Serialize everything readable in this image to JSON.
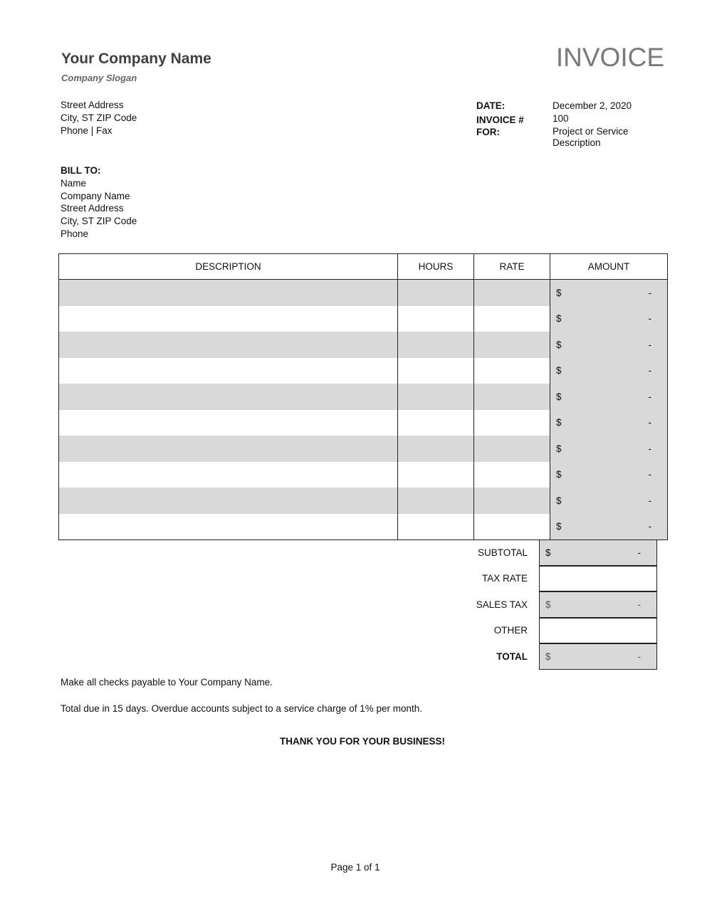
{
  "header": {
    "company_name": "Your Company Name",
    "company_slogan": "Company Slogan",
    "document_title": "INVOICE"
  },
  "from": {
    "lines": [
      "Street Address",
      "City, ST  ZIP Code",
      "Phone | Fax"
    ]
  },
  "meta": {
    "rows": [
      {
        "label": "DATE:",
        "value": "December 2, 2020"
      },
      {
        "label": "INVOICE #",
        "value": "100"
      },
      {
        "label": "FOR:",
        "value": "Project or Service Description"
      }
    ]
  },
  "bill_to": {
    "heading": "BILL TO:",
    "lines": [
      "Name",
      "Company Name",
      "Street Address",
      "City, ST  ZIP Code",
      "Phone"
    ]
  },
  "items_table": {
    "columns": [
      "DESCRIPTION",
      "HOURS",
      "RATE",
      "AMOUNT"
    ],
    "rows": [
      {
        "description": "",
        "hours": "",
        "rate": "",
        "currency": "$",
        "amount": "-"
      },
      {
        "description": "",
        "hours": "",
        "rate": "",
        "currency": "$",
        "amount": "-"
      },
      {
        "description": "",
        "hours": "",
        "rate": "",
        "currency": "$",
        "amount": "-"
      },
      {
        "description": "",
        "hours": "",
        "rate": "",
        "currency": "$",
        "amount": "-"
      },
      {
        "description": "",
        "hours": "",
        "rate": "",
        "currency": "$",
        "amount": "-"
      },
      {
        "description": "",
        "hours": "",
        "rate": "",
        "currency": "$",
        "amount": "-"
      },
      {
        "description": "",
        "hours": "",
        "rate": "",
        "currency": "$",
        "amount": "-"
      },
      {
        "description": "",
        "hours": "",
        "rate": "",
        "currency": "$",
        "amount": "-"
      },
      {
        "description": "",
        "hours": "",
        "rate": "",
        "currency": "$",
        "amount": "-"
      },
      {
        "description": "",
        "hours": "",
        "rate": "",
        "currency": "$",
        "amount": "-"
      }
    ]
  },
  "totals": {
    "subtotal": {
      "label": "SUBTOTAL",
      "currency": "$",
      "value": "-"
    },
    "tax_rate": {
      "label": "TAX RATE",
      "value": ""
    },
    "sales_tax": {
      "label": "SALES TAX",
      "currency": "$",
      "value": "-"
    },
    "other": {
      "label": "OTHER",
      "value": ""
    },
    "total": {
      "label": "TOTAL",
      "currency": "$",
      "value": "-"
    }
  },
  "footer": {
    "payable_note": "Make all checks payable to Your Company Name.",
    "terms_note": "Total due in 15 days. Overdue accounts subject to a service charge of 1% per month.",
    "thank_you": "THANK YOU FOR YOUR BUSINESS!",
    "page_indicator": "Page 1 of 1"
  },
  "colors": {
    "shade": "#d9d9d9",
    "title_gray": "#7a7a7a",
    "company_gray": "#404040"
  }
}
